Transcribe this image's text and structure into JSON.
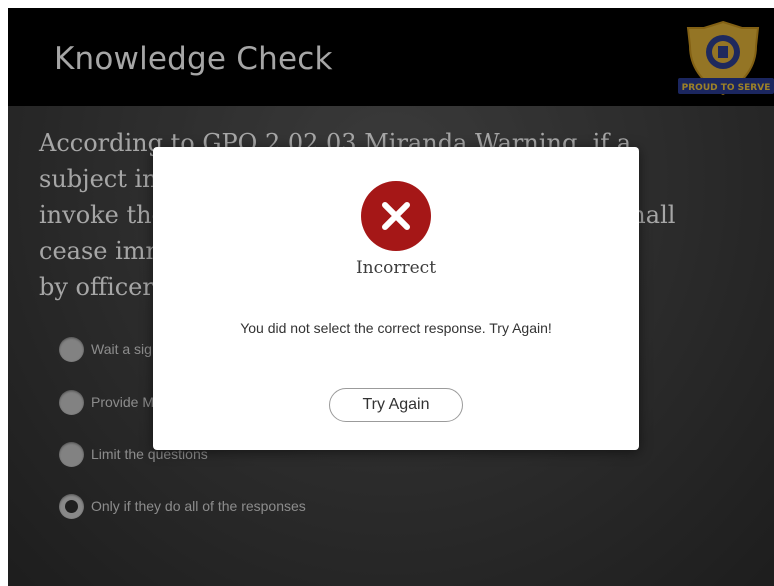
{
  "header": {
    "title": "Knowledge Check",
    "badge": {
      "icon": "police-badge-logo",
      "text": "PROUD TO SERVE"
    }
  },
  "question": {
    "lines": [
      "According to GPO 2.02.03 Miranda Warning, if a",
      "subject in custody indicates they do not want to",
      "invoke their right to remain silent, questioning shall",
      "cease immediately and may only be resumed",
      "by officers when:"
    ]
  },
  "options": [
    {
      "label": "Wait a significant period of time before",
      "selected": false
    },
    {
      "label": "Provide Miranda Warning again",
      "selected": false
    },
    {
      "label": "Limit the questions",
      "selected": false
    },
    {
      "label": "Only if they do all of the responses",
      "selected": true
    }
  ],
  "modal": {
    "icon": "error-x-icon",
    "status_color": "#a51717",
    "title": "Incorrect",
    "message": "You did not select the correct response. Try Again!",
    "button_label": "Try Again"
  }
}
